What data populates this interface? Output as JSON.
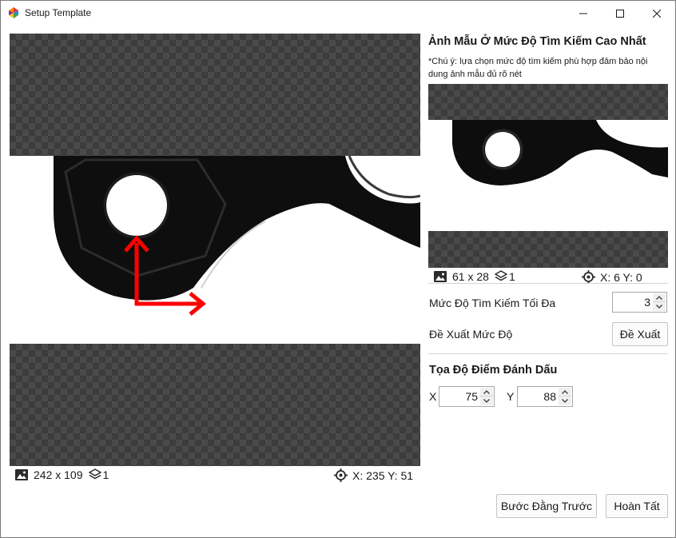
{
  "window": {
    "title": "Setup Template"
  },
  "main_image": {
    "size": "242 x 109",
    "layers": "1",
    "coords": "X: 235 Y: 51"
  },
  "template_panel": {
    "title": "Ảnh Mẫu Ở Mức Độ Tìm Kiếm Cao Nhất",
    "note": "*Chú ý: lựa chọn mức độ tìm kiếm phù hợp đảm bảo nội dung ảnh mẫu đủ rõ nét",
    "size": "61 x 28",
    "layers": "1",
    "coords": "X: 6 Y: 0"
  },
  "search_level": {
    "label": "Mức Độ Tìm Kiếm Tối Đa",
    "value": "3"
  },
  "suggest": {
    "label": "Đề Xuất Mức Độ",
    "button": "Đề Xuất"
  },
  "marker": {
    "title": "Tọa Độ Điểm Đánh Dấu",
    "x_label": "X",
    "x_value": "75",
    "y_label": "Y",
    "y_value": "88"
  },
  "footer": {
    "back_button": "Bước Đằng Trước",
    "finish_button": "Hoàn Tất"
  },
  "colors": {
    "arrow": "#ff0000",
    "checker_dark": "#3c3c3c",
    "checker_light": "#4a4a4a"
  }
}
